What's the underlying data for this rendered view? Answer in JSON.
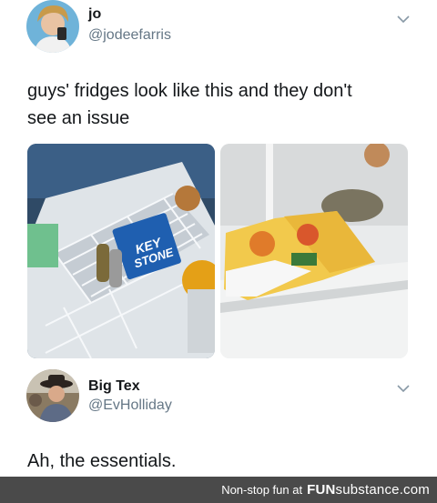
{
  "tweet1": {
    "display_name": "jo",
    "handle": "@jodeefarris",
    "text_line1": "guys' fridges look like this and they don't",
    "text_line2": "see an issue"
  },
  "tweet2": {
    "display_name": "Big Tex",
    "handle": "@EvHolliday",
    "text": "Ah, the essentials."
  },
  "photo_labels": {
    "can_brand": "KEY\nSTONE"
  },
  "footer": {
    "tagline": "Non-stop fun at",
    "brand_bold": "FUN",
    "brand_rest": "substance.com"
  },
  "colors": {
    "handle_gray": "#657786",
    "footer_bg": "#4a4a4a",
    "text_dark": "#14171a"
  }
}
